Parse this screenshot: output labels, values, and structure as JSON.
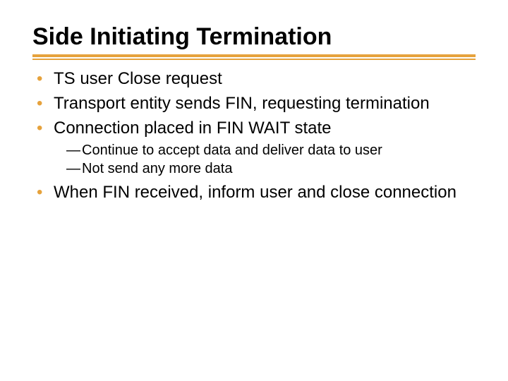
{
  "title": "Side Initiating Termination",
  "bullets": [
    {
      "text": "TS user Close request"
    },
    {
      "text": "Transport entity sends FIN, requesting termination"
    },
    {
      "text": "Connection placed in FIN WAIT state",
      "sub": [
        "Continue to accept data and deliver data to user",
        "Not send any more data"
      ]
    },
    {
      "text": "When FIN received, inform user and close connection"
    }
  ]
}
